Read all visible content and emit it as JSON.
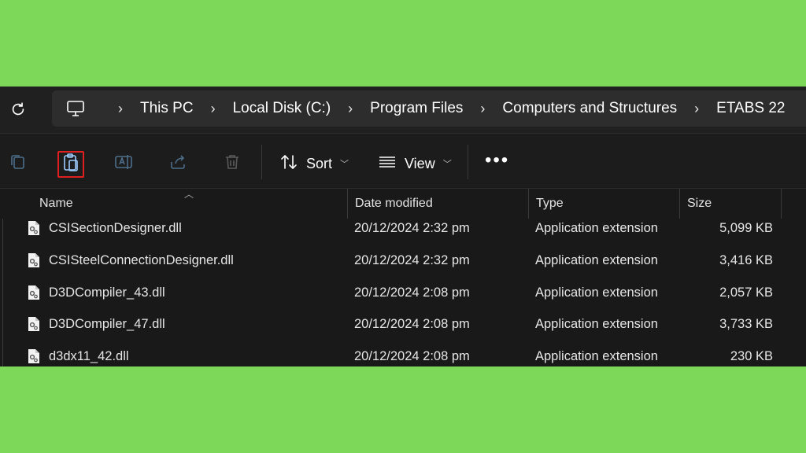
{
  "colors": {
    "page_bg": "#7dd85a",
    "window_bg": "#191919",
    "highlight": "#e02020",
    "text": "#ffffff"
  },
  "address_bar": {
    "refresh_icon": "refresh-icon",
    "pc_icon": "monitor-icon",
    "breadcrumbs": [
      "This PC",
      "Local Disk (C:)",
      "Program Files",
      "Computers and Structures",
      "ETABS 22"
    ]
  },
  "toolbar": {
    "icons": [
      "copy-icon",
      "paste-icon",
      "rename-icon",
      "share-icon",
      "delete-icon"
    ],
    "sort_label": "Sort",
    "view_label": "View",
    "more_label": "•••"
  },
  "columns": {
    "name": "Name",
    "date": "Date modified",
    "type": "Type",
    "size": "Size"
  },
  "files": [
    {
      "name": "CSISectionDesigner.dll",
      "date": "20/12/2024 2:32 pm",
      "type": "Application extension",
      "size": "5,099 KB"
    },
    {
      "name": "CSISteelConnectionDesigner.dll",
      "date": "20/12/2024 2:32 pm",
      "type": "Application extension",
      "size": "3,416 KB"
    },
    {
      "name": "D3DCompiler_43.dll",
      "date": "20/12/2024 2:08 pm",
      "type": "Application extension",
      "size": "2,057 KB"
    },
    {
      "name": "D3DCompiler_47.dll",
      "date": "20/12/2024 2:08 pm",
      "type": "Application extension",
      "size": "3,733 KB"
    },
    {
      "name": "d3dx11_42.dll",
      "date": "20/12/2024 2:08 pm",
      "type": "Application extension",
      "size": "230 KB"
    }
  ]
}
